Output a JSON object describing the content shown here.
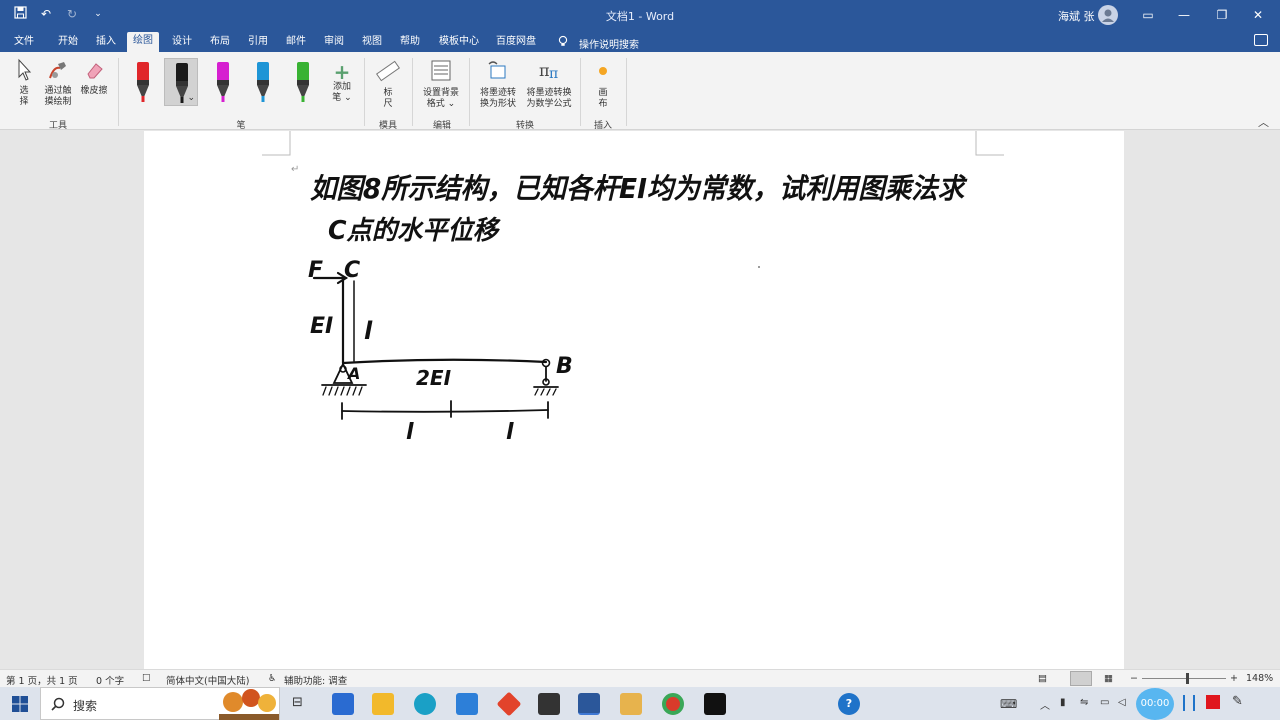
{
  "window": {
    "title": "文档1 - Word",
    "user_name": "海斌 张"
  },
  "tabs": [
    {
      "label": "文件"
    },
    {
      "label": "开始"
    },
    {
      "label": "插入"
    },
    {
      "label": "绘图"
    },
    {
      "label": "设计"
    },
    {
      "label": "布局"
    },
    {
      "label": "引用"
    },
    {
      "label": "邮件"
    },
    {
      "label": "审阅"
    },
    {
      "label": "视图"
    },
    {
      "label": "帮助"
    },
    {
      "label": "模板中心"
    },
    {
      "label": "百度网盘"
    }
  ],
  "tell_me": "操作说明搜索",
  "ribbon": {
    "tools": {
      "select_l1": "选",
      "select_l2": "择",
      "touch_l1": "通过触",
      "touch_l2": "摸绘制",
      "eraser": "橡皮擦",
      "group": "工具"
    },
    "pens": {
      "add_l1": "添加",
      "add_l2": "笔 ⌄",
      "group": "笔",
      "colors": [
        "#e0262a",
        "#1a1a1a",
        "#d61fd0",
        "#1e95d6",
        "#38b233"
      ]
    },
    "stencils": {
      "ruler_l1": "标",
      "ruler_l2": "尺",
      "group": "模具"
    },
    "edit": {
      "bg_l1": "设置背景",
      "bg_l2": "格式 ⌄",
      "group": "编辑"
    },
    "convert": {
      "shape_l1": "将墨迹转",
      "shape_l2": "换为形状",
      "math_l1": "将墨迹转换",
      "math_l2": "为数学公式",
      "group": "转换"
    },
    "insert": {
      "canvas_l1": "画",
      "canvas_l2": "布",
      "group": "插入"
    }
  },
  "document": {
    "line1": "如图8所示结构，已知各杆EI均为常数，试利用图乘法求",
    "line2": "C点的水平位移",
    "labels": {
      "force": "F",
      "point_c": "C",
      "ei_column": "EI",
      "l_column": "l",
      "point_a": "A",
      "ei_beam": "2EI",
      "point_b": "B",
      "l_left": "l",
      "l_right": "l"
    }
  },
  "status": {
    "page": "第 1 页，共 1 页",
    "words": "0 个字",
    "language": "简体中文(中国大陆)",
    "accessibility": "辅助功能: 调查",
    "zoom": "148%"
  },
  "taskbar": {
    "search": "搜索",
    "timer": "00:00"
  }
}
